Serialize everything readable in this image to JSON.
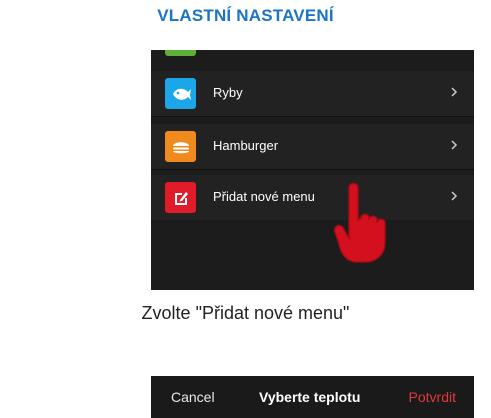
{
  "header": {
    "title": "VLASTNÍ NASTAVENÍ"
  },
  "menu": {
    "items": [
      {
        "label": "Ryby",
        "icon": "fish-icon",
        "color": "#1aa6e8"
      },
      {
        "label": "Hamburger",
        "icon": "burger-icon",
        "color": "#f08a1c"
      },
      {
        "label": "Přidat nové menu",
        "icon": "edit-icon",
        "color": "#e01b2a"
      }
    ]
  },
  "caption": "Zvolte \"Přidat nové menu\"",
  "bottom_bar": {
    "cancel_label": "Cancel",
    "title": "Vyberte teplotu",
    "confirm_label": "Potvrdit"
  }
}
